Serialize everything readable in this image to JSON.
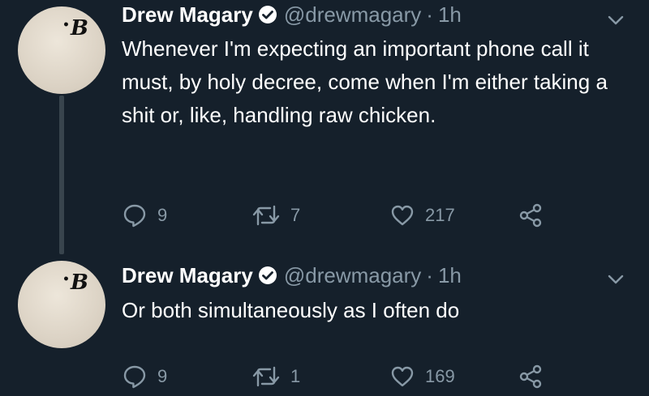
{
  "tweets": [
    {
      "author_name": "Drew Magary",
      "handle": "@drewmagary",
      "separator": "·",
      "time": "1h",
      "text": "Whenever I'm expecting an important phone call it must, by holy decree, come when I'm either taking a shit or, like, handling raw chicken.",
      "avatar_logo": "B",
      "replies": "9",
      "retweets": "7",
      "likes": "217"
    },
    {
      "author_name": "Drew Magary",
      "handle": "@drewmagary",
      "separator": "·",
      "time": "1h",
      "text": "Or both simultaneously as I often do",
      "avatar_logo": "B",
      "replies": "9",
      "retweets": "1",
      "likes": "169"
    }
  ],
  "icons": {
    "verified": "verified-badge-icon",
    "menu": "chevron-down-icon",
    "reply": "reply-icon",
    "retweet": "retweet-icon",
    "like": "heart-icon",
    "share": "share-icon"
  },
  "colors": {
    "background": "#15202b",
    "text_primary": "#ffffff",
    "text_secondary": "#8899a6",
    "thread_line": "#38444d"
  }
}
